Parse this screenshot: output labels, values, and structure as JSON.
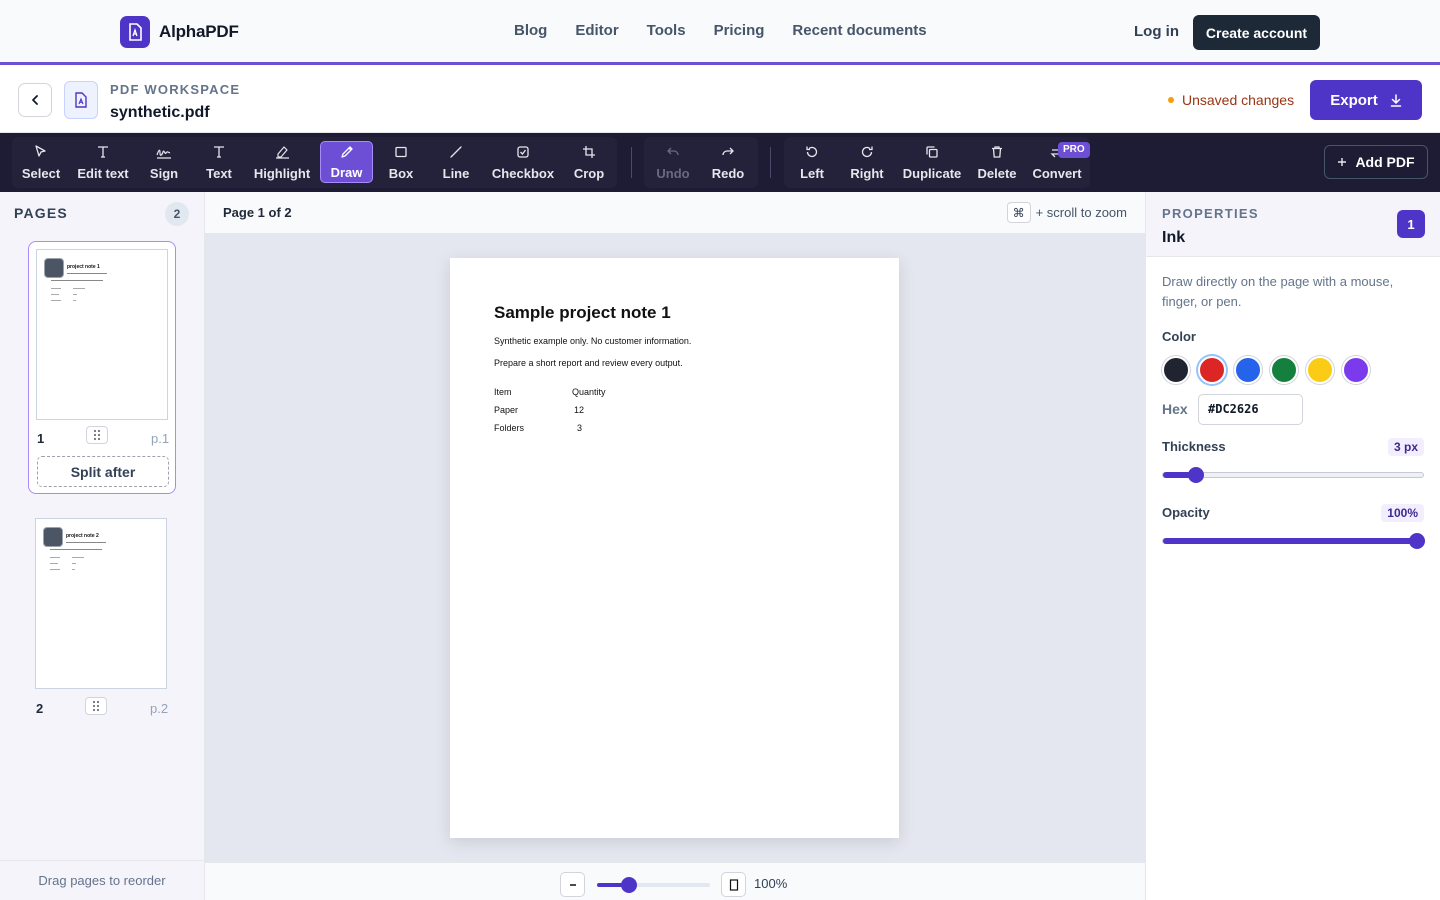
{
  "brand": {
    "name": "AlphaPDF",
    "accent": "#4F35C7"
  },
  "nav": {
    "links": [
      "Blog",
      "Editor",
      "Tools",
      "Pricing",
      "Recent documents"
    ],
    "login": "Log in",
    "create_account": "Create account"
  },
  "workspace": {
    "label": "PDF WORKSPACE",
    "filename": "synthetic.pdf",
    "status": "Unsaved changes",
    "export": "Export"
  },
  "toolbar": {
    "tools": [
      "Select",
      "Edit text",
      "Sign",
      "Text",
      "Highlight",
      "Draw",
      "Box",
      "Line",
      "Checkbox",
      "Crop"
    ],
    "active_tool": "Draw",
    "history": [
      "Undo",
      "Redo"
    ],
    "page_ops": [
      "Left",
      "Right",
      "Duplicate",
      "Delete",
      "Convert"
    ],
    "pro_badge": "PRO",
    "add_pdf": "Add PDF"
  },
  "pages_panel": {
    "title": "PAGES",
    "count": "2",
    "pages": [
      {
        "number": "1",
        "ref": "p.1",
        "thumb_title": "project note 1"
      },
      {
        "number": "2",
        "ref": "p.2",
        "thumb_title": "project note 2"
      }
    ],
    "split_after": "Split after",
    "footer": "Drag pages to reorder"
  },
  "canvas": {
    "page_indicator": "Page 1 of 2",
    "zoom_key": "⌘",
    "zoom_hint": "+ scroll to zoom",
    "zoom_value": "100%",
    "zoom_level": 0.25
  },
  "document": {
    "title": "Sample project note 1",
    "lines": [
      "Synthetic example only. No customer information.",
      "Prepare a short report and review every output."
    ],
    "table": {
      "headers": [
        "Item",
        "Quantity"
      ],
      "rows": [
        [
          "Paper",
          "12"
        ],
        [
          "Folders",
          "3"
        ]
      ]
    }
  },
  "properties": {
    "label": "PROPERTIES",
    "tool_name": "Ink",
    "badge": "1",
    "description": "Draw directly on the page with a mouse, finger, or pen.",
    "color_label": "Color",
    "colors": [
      "#1F2430",
      "#DC2626",
      "#2563EB",
      "#15803D",
      "#FACC15",
      "#7C3AED"
    ],
    "selected_color": "#DC2626",
    "hex_label": "Hex",
    "hex_value": "#DC2626",
    "thickness_label": "Thickness",
    "thickness_value": "3 px",
    "thickness_level": 0.1,
    "opacity_label": "Opacity",
    "opacity_value": "100%",
    "opacity_level": 1.0
  }
}
